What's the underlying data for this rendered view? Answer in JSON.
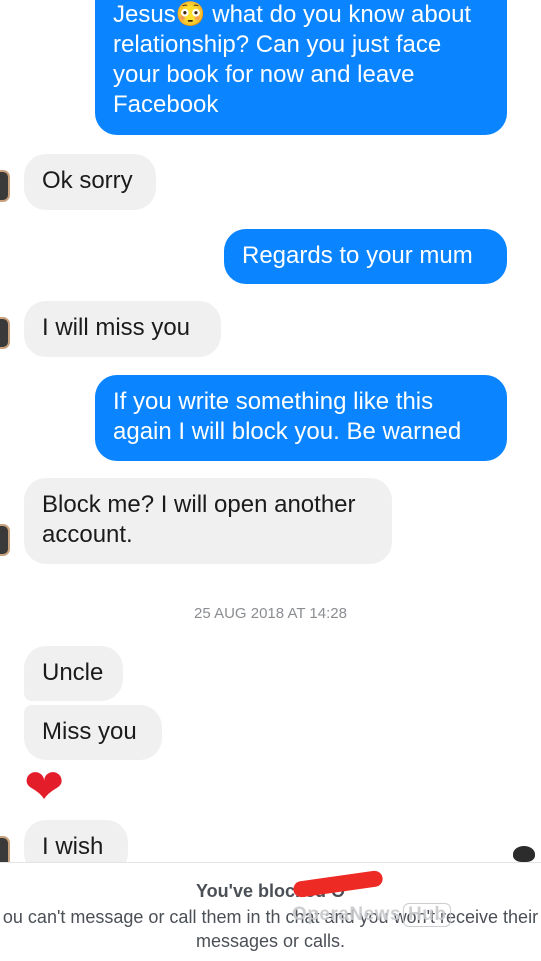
{
  "messages": [
    {
      "text": "Jesus😳 what do you know about relationship? Can you just face your book for now and leave Facebook"
    },
    {
      "text": "Ok sorry"
    },
    {
      "text": "Regards to your mum"
    },
    {
      "text": "I will miss you"
    },
    {
      "text": "If you write something like this again I will block you. Be warned"
    },
    {
      "text": "Block me? I will open another account."
    },
    {
      "text": "Uncle"
    },
    {
      "text": "Miss you"
    },
    {
      "text": "❤"
    },
    {
      "text": "I wish"
    }
  ],
  "timestamp": "25 AUG 2018 AT 14:28",
  "footer": {
    "blocked_title": "You've blocked O",
    "blocked_body": "ou can't message or call them in th  chat and you won't receive their messages or calls."
  },
  "watermark": {
    "text": "OperaNews",
    "hub": "Hub"
  },
  "colors": {
    "outgoing": "#0a84ff",
    "incoming": "#f0f0f1",
    "redaction": "#ee2a24"
  }
}
